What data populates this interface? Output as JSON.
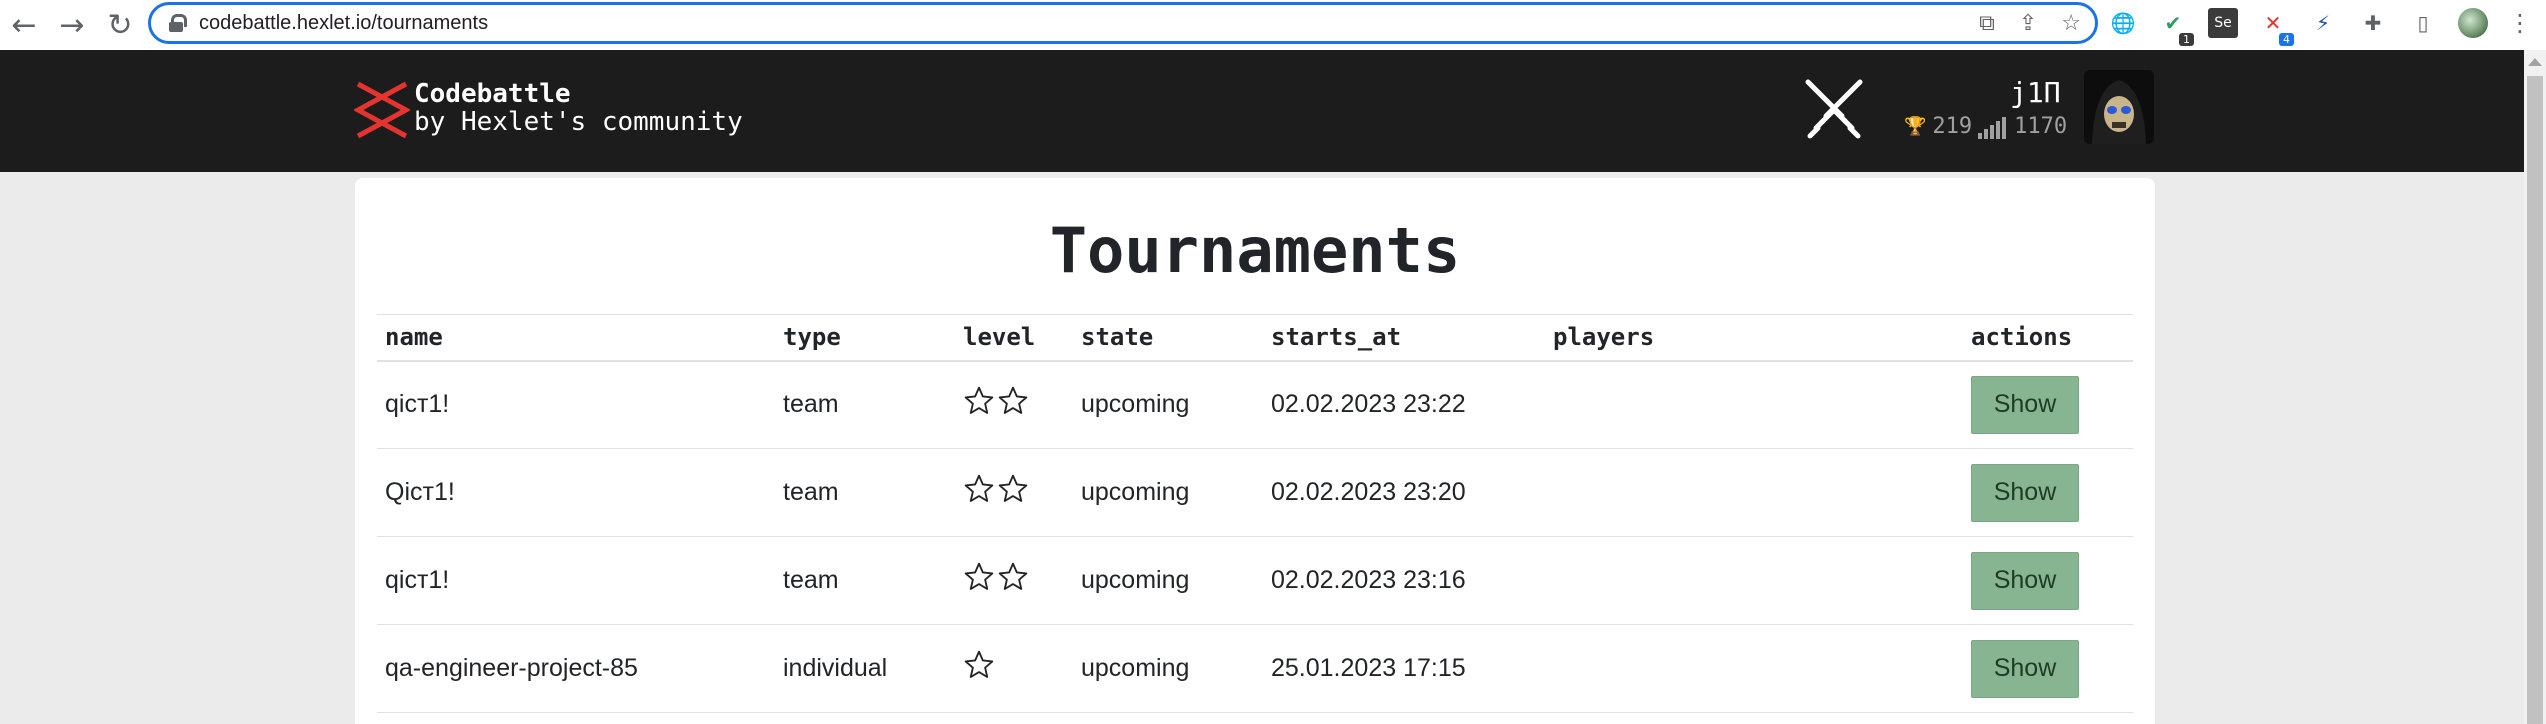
{
  "browser": {
    "url": "codebattle.hexlet.io/tournaments",
    "extensions": [
      {
        "icon": "globe-icon"
      },
      {
        "icon": "shield-check-icon",
        "badge": "1"
      },
      {
        "icon": "selenium-icon",
        "label": "Se"
      },
      {
        "icon": "codebattle-ext-icon",
        "badge": "4"
      },
      {
        "icon": "bolt-icon"
      },
      {
        "icon": "puzzle-icon"
      },
      {
        "icon": "sidebar-icon"
      }
    ]
  },
  "header": {
    "brand_title": "Codebattle",
    "brand_subtitle": "by Hexlet's community",
    "user": {
      "name": "j1П",
      "trophies": "219",
      "rating": "1170"
    }
  },
  "page": {
    "title": "Tournaments"
  },
  "table": {
    "columns": [
      "name",
      "type",
      "level",
      "state",
      "starts_at",
      "players",
      "actions"
    ],
    "rows": [
      {
        "name": "qicт1!",
        "type": "team",
        "stars": 2,
        "state": "upcoming",
        "starts_at": "02.02.2023 23:22",
        "players": "",
        "action": "Show"
      },
      {
        "name": "Qicт1!",
        "type": "team",
        "stars": 2,
        "state": "upcoming",
        "starts_at": "02.02.2023 23:20",
        "players": "",
        "action": "Show"
      },
      {
        "name": "qicт1!",
        "type": "team",
        "stars": 2,
        "state": "upcoming",
        "starts_at": "02.02.2023 23:16",
        "players": "",
        "action": "Show"
      },
      {
        "name": "qa-engineer-project-85",
        "type": "individual",
        "stars": 1,
        "state": "upcoming",
        "starts_at": "25.01.2023 17:15",
        "players": "",
        "action": "Show"
      }
    ]
  },
  "colors": {
    "header_bg": "#1c1c1c",
    "logo_red": "#e3342f",
    "show_button": "#88b591"
  }
}
